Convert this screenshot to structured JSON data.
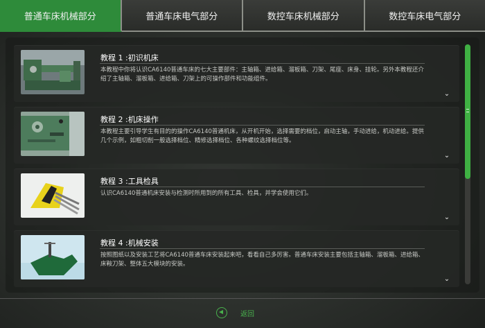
{
  "tabs": [
    {
      "label": "普通车床机械部分",
      "active": true
    },
    {
      "label": "普通车床电气部分",
      "active": false
    },
    {
      "label": "数控车床机械部分",
      "active": false
    },
    {
      "label": "数控车床电气部分",
      "active": false
    }
  ],
  "tutorials": [
    {
      "title": "教程 1 :初识机床",
      "description": "本教程中你将认识CA6140普通车床的七大主要部件：主轴箱、进给箱、溜板箱、刀架、尾座、床身、挂轮。另外本教程还介绍了主轴箱、溜板箱、进给箱、刀架上的可操作部件和功能组件。"
    },
    {
      "title": "教程 2 :机床操作",
      "description": "本教程主要引导学生有目的的操作CA6140普通机床，从开机开始，选择需要的档位，启动主轴，手动进给，机动进给。提供几个示例，如粗切削一般选择档位、精修选择档位、各种螺纹选择档位等。"
    },
    {
      "title": "教程 3 :工具检具",
      "description": "认识CA6140普通机床安装与检测时所用到的所有工具、检具，并学会使用它们。"
    },
    {
      "title": "教程 4 :机械安装",
      "description": "按照图纸以及安装工艺将CA6140普通车床安装起来吧，看看自己多厉害。普通车床安装主要包括主轴箱、溜板箱、进给箱、床鞍刀架、整体五大模块的安装。"
    }
  ],
  "footer": {
    "back_label": "返回"
  },
  "colors": {
    "accent": "#2e8b3a",
    "back_green": "#49b24d",
    "scrollbar": "#3fb043"
  }
}
